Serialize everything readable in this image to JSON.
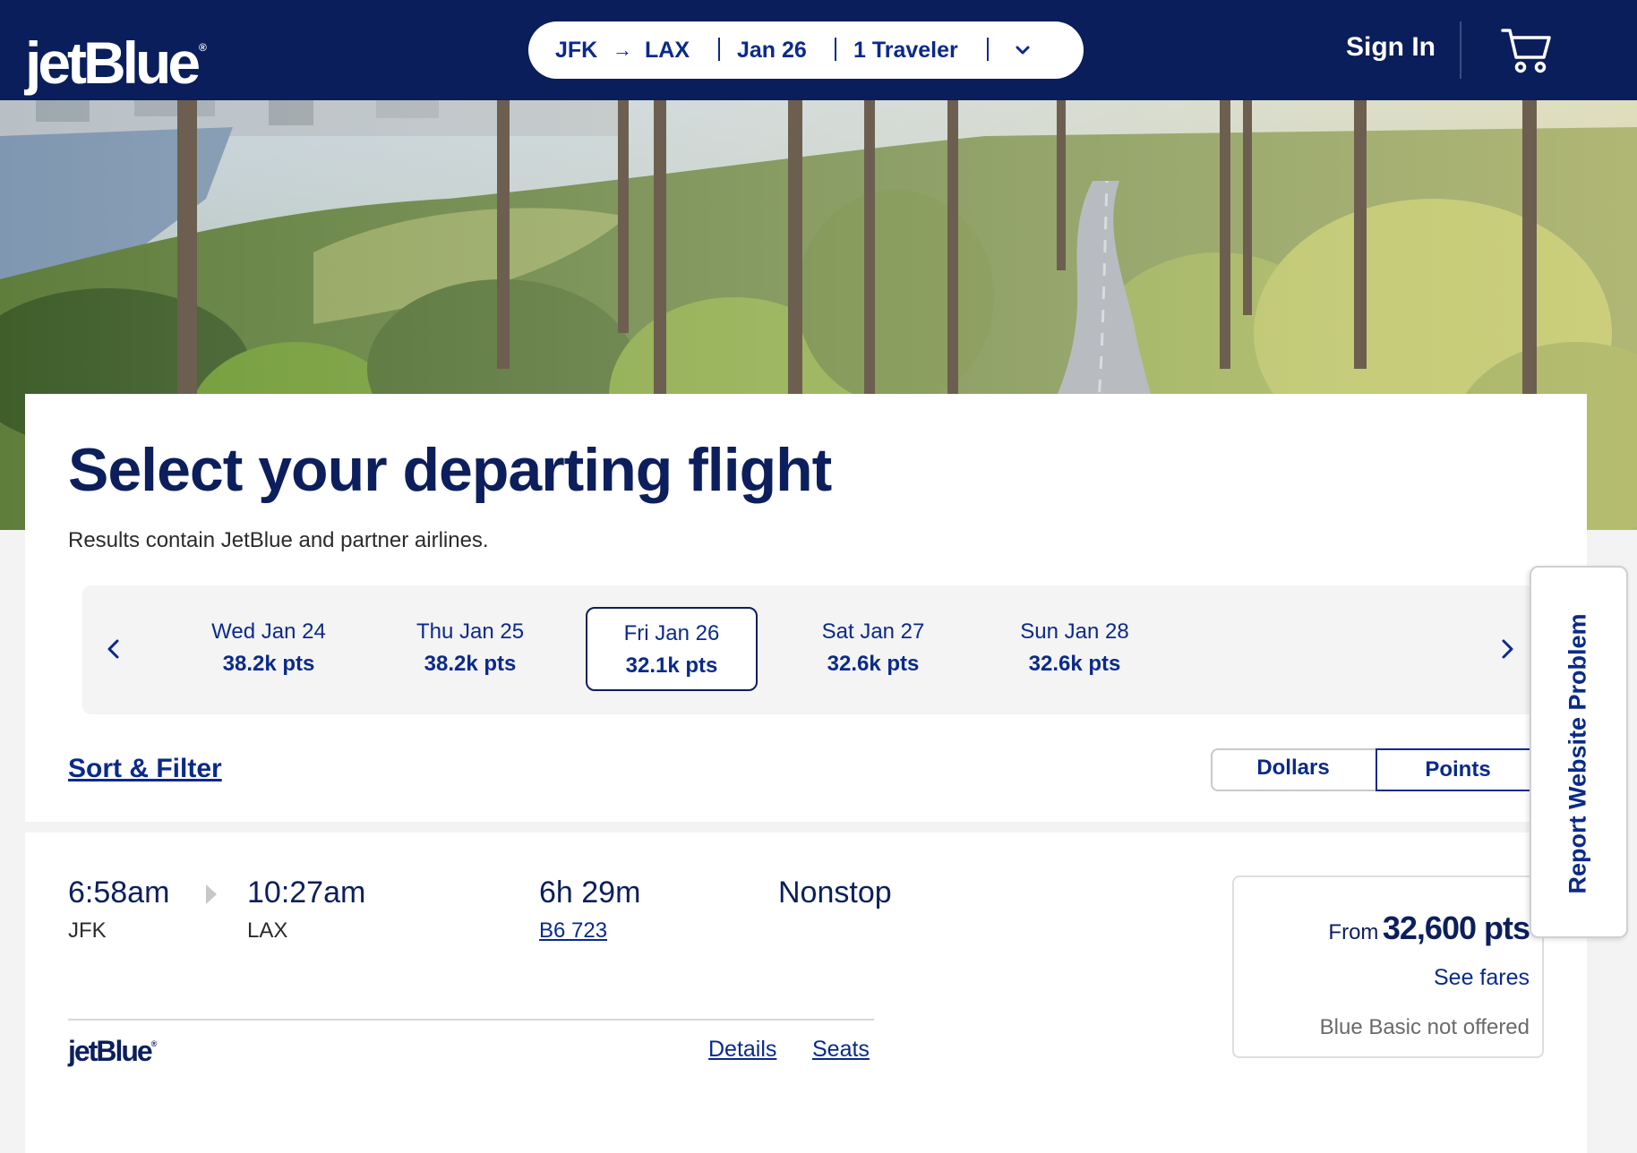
{
  "header": {
    "logo": "jetBlue",
    "trip": {
      "origin": "JFK",
      "arrow": "→",
      "destination": "LAX",
      "date": "Jan 26",
      "travelers": "1 Traveler"
    },
    "sign_in": "Sign In"
  },
  "main": {
    "title": "Select your departing flight",
    "subtitle": "Results contain JetBlue and partner airlines.",
    "dates": [
      {
        "day": "Wed Jan 24",
        "price": "38.2k pts",
        "selected": false
      },
      {
        "day": "Thu Jan 25",
        "price": "38.2k pts",
        "selected": false
      },
      {
        "day": "Fri Jan 26",
        "price": "32.1k pts",
        "selected": true
      },
      {
        "day": "Sat Jan 27",
        "price": "32.6k pts",
        "selected": false
      },
      {
        "day": "Sun Jan 28",
        "price": "32.6k pts",
        "selected": false
      }
    ],
    "sort_filter": "Sort & Filter",
    "currency_toggle": {
      "dollars": "Dollars",
      "points": "Points",
      "active": "Points"
    }
  },
  "flight": {
    "depart_time": "6:58am",
    "depart_code": "JFK",
    "arrive_time": "10:27am",
    "arrive_code": "LAX",
    "duration": "6h 29m",
    "flight_number": "B6 723",
    "stops": "Nonstop",
    "airline_logo": "jetBlue",
    "details": "Details",
    "seats": "Seats",
    "price_from": "From",
    "price_amount": "32,600 pts",
    "see_fares": "See fares",
    "fare_note": "Blue Basic not offered"
  },
  "report_tab": "Report Website Problem",
  "colors": {
    "brand_navy": "#0a1e5b",
    "link_blue": "#0a2a8a",
    "text_dark": "#0c1f5c"
  }
}
